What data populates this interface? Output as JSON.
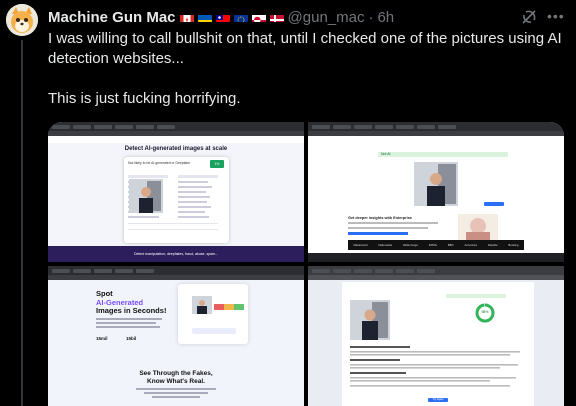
{
  "tweet": {
    "display_name": "Machine Gun Mac",
    "handle": "@gun_mac",
    "separator": "·",
    "time": "6h",
    "paragraphs": [
      "I was willing to call bullshit on that, until I checked one of the pictures using AI detection websites...",
      "This is just fucking horrifying."
    ]
  },
  "header_icons": [
    "grok-icon",
    "more-icon"
  ],
  "flags": [
    "canada-flag",
    "ukraine-flag",
    "taiwan-flag",
    "eu-flag",
    "greenland-flag",
    "denmark-flag"
  ],
  "screenshots": {
    "top_left": {
      "heading": "Detect AI-generated images at scale",
      "verdict_label": "Not likely to be AI-generated or Deepfake",
      "verdict_score": "1%",
      "footer": "Detect manipulation, deepfakes, fraud, abuse, spam..."
    },
    "top_right": {
      "result_banner": "Not AI",
      "section_heading": "Get deeper insights with Enterprise",
      "logos": [
        "Mastercard",
        "Nationwide",
        "Wells Fargo",
        "KPMG",
        "BBC",
        "Accenture",
        "Deloitte",
        "Booking"
      ]
    },
    "bottom_left": {
      "title_line1": "Spot",
      "title_highlight": "AI-Generated",
      "title_line3": "Images in Seconds!",
      "stat1": "15mil",
      "stat2": "15bil",
      "tagline_line1": "See Through the Fakes,",
      "tagline_line2": "Know What's Real."
    },
    "bottom_right": {
      "probability": "98%",
      "button_label": "Try Again"
    }
  },
  "colors": {
    "background": "#000000",
    "text": "#e7e9ea",
    "muted": "#71767b",
    "divider": "#333639"
  }
}
